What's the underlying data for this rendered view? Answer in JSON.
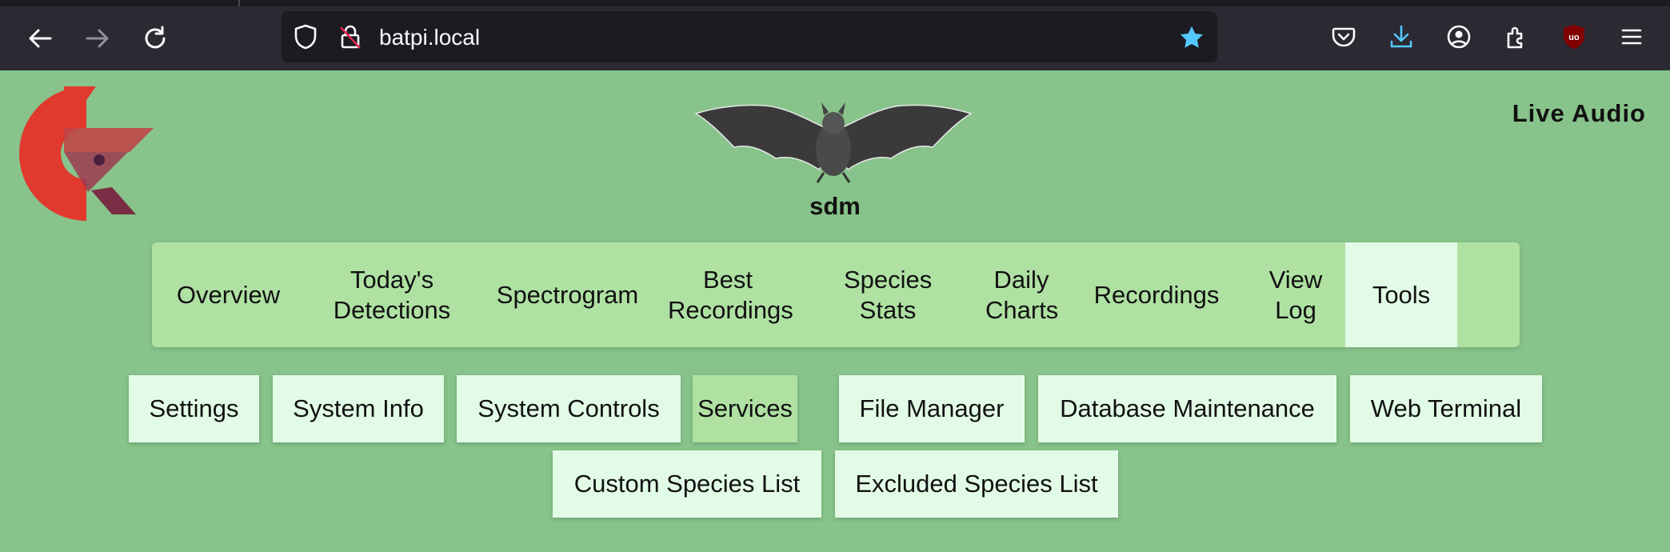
{
  "browser": {
    "url": "batpi.local",
    "icons": [
      "back-icon",
      "forward-icon",
      "reload-icon",
      "shield-icon",
      "lock-insecure-icon",
      "bookmark-star-icon",
      "pocket-icon",
      "download-icon",
      "account-icon",
      "extensions-icon",
      "ublock-icon",
      "menu-icon"
    ],
    "accent": "#54c8fd"
  },
  "site": {
    "name": "sdm",
    "live_audio": "Live Audio"
  },
  "main_nav": [
    {
      "label": "Overview"
    },
    {
      "label": "Today's Detections"
    },
    {
      "label": "Spectrogram"
    },
    {
      "label": "Best Recordings"
    },
    {
      "label": "Species Stats"
    },
    {
      "label": "Daily Charts"
    },
    {
      "label": "Recordings"
    },
    {
      "label": "View Log"
    },
    {
      "label": "Tools",
      "active": true
    }
  ],
  "tools_nav": [
    {
      "label": "Settings"
    },
    {
      "label": "System Info"
    },
    {
      "label": "System Controls"
    },
    {
      "label": "Services",
      "active": true
    },
    {
      "label": "File Manager"
    },
    {
      "label": "Database Maintenance"
    },
    {
      "label": "Web Terminal"
    },
    {
      "label": "Custom Species List"
    },
    {
      "label": "Excluded Species List"
    }
  ],
  "colors": {
    "page_bg": "#87c38a",
    "nav_bg": "#afe1a3",
    "button_bg": "#e2fbe6"
  }
}
